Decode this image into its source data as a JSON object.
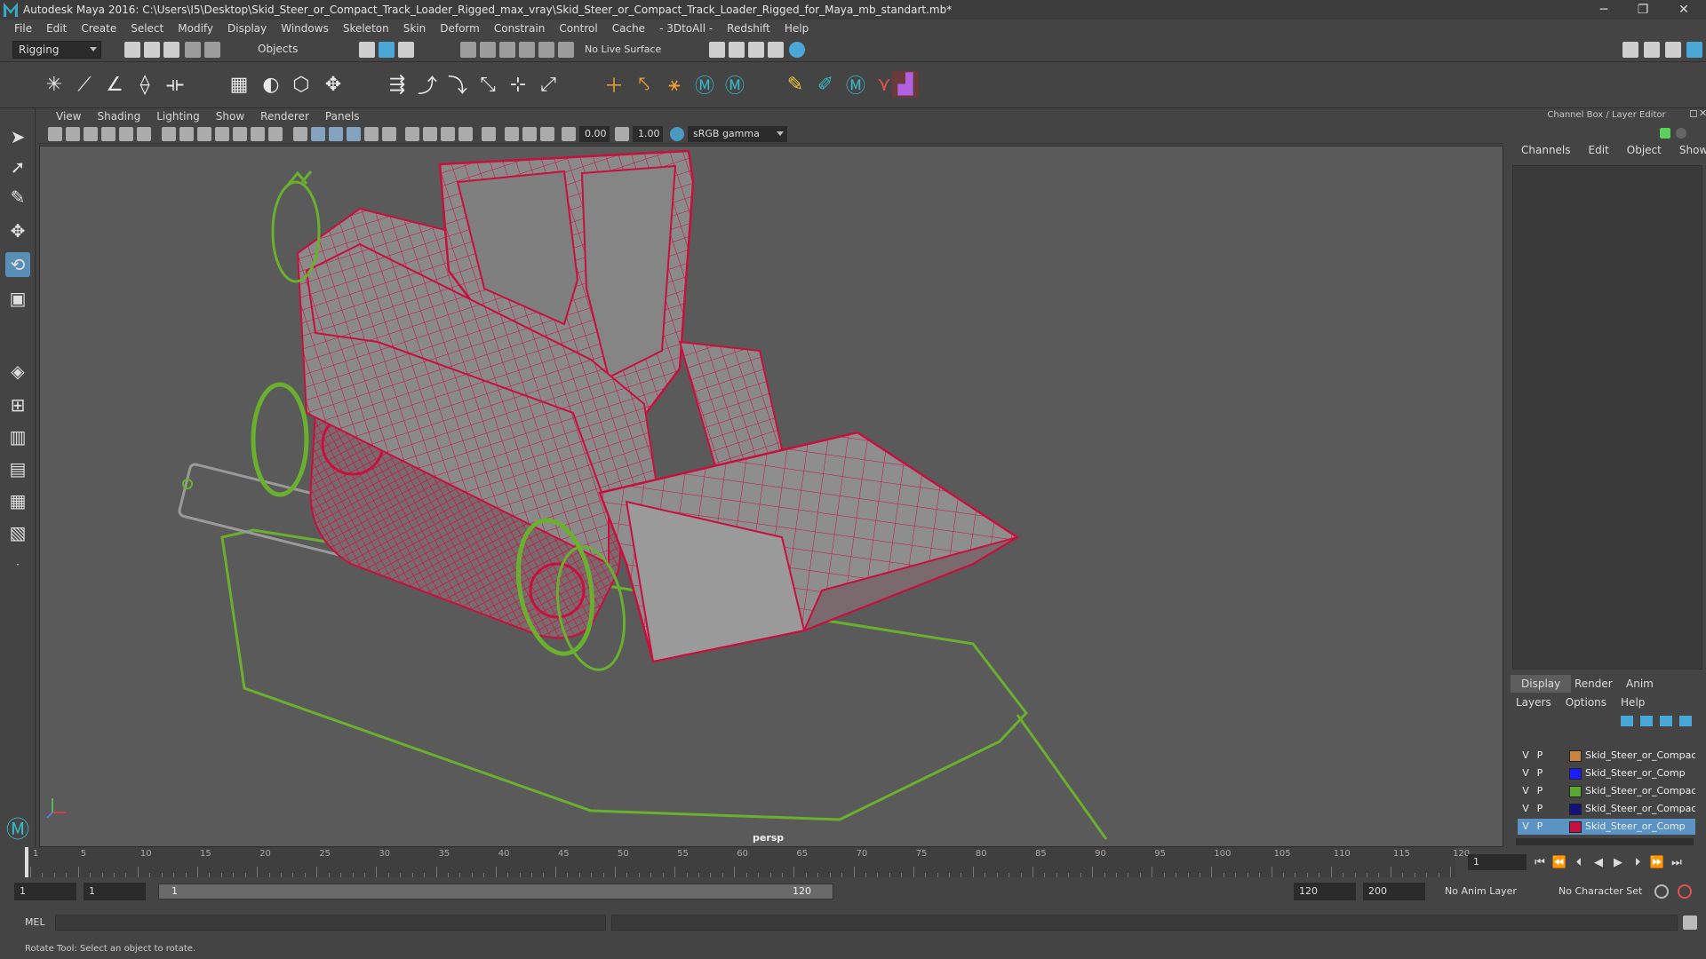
{
  "window": {
    "title": "Autodesk Maya 2016: C:\\Users\\I5\\Desktop\\Skid_Steer_or_Compact_Track_Loader_Rigged_max_vray\\Skid_Steer_or_Compact_Track_Loader_Rigged_for_Maya_mb_standart.mb*",
    "min": "─",
    "max": "❐",
    "close": "✕"
  },
  "menubar": [
    "File",
    "Edit",
    "Create",
    "Select",
    "Modify",
    "Display",
    "Windows",
    "Skeleton",
    "Skin",
    "Deform",
    "Constrain",
    "Control",
    "Cache",
    "- 3DtoAll -",
    "Redshift",
    "Help"
  ],
  "statusline": {
    "mode": "Rigging",
    "selection_mode": "Objects",
    "live_surface": "No Live Surface"
  },
  "viewport": {
    "menu": [
      "View",
      "Shading",
      "Lighting",
      "Show",
      "Renderer",
      "Panels"
    ],
    "exposure": "0.00",
    "gamma": "1.00",
    "color_space": "sRGB gamma",
    "camera_label": "persp"
  },
  "channel_box": {
    "header": "Channel Box / Layer Editor",
    "tabs": [
      "Channels",
      "Edit",
      "Object",
      "Show"
    ]
  },
  "layer_editor": {
    "tabs": [
      "Display",
      "Render",
      "Anim"
    ],
    "menu": [
      "Layers",
      "Options",
      "Help"
    ],
    "layers": [
      {
        "v": "V",
        "p": "P",
        "color": "#c9843f",
        "name": "Skid_Steer_or_Compac"
      },
      {
        "v": "V",
        "p": "P",
        "color": "#1b1bff",
        "name": "Skid_Steer_or_Comp"
      },
      {
        "v": "V",
        "p": "P",
        "color": "#5aa832",
        "name": "Skid_Steer_or_Compact_Tr"
      },
      {
        "v": "V",
        "p": "P",
        "color": "#12127a",
        "name": "Skid_Steer_or_Compact_"
      },
      {
        "v": "V",
        "p": "P",
        "color": "#c8103f",
        "name": "Skid_Steer_or_Comp",
        "selected": true
      }
    ]
  },
  "timeline": {
    "ticks": [
      "1",
      "5",
      "10",
      "15",
      "20",
      "25",
      "30",
      "35",
      "40",
      "45",
      "50",
      "55",
      "60",
      "65",
      "70",
      "75",
      "80",
      "85",
      "90",
      "95",
      "100",
      "105",
      "110",
      "115",
      "120"
    ],
    "current_frame": "1"
  },
  "range": {
    "start": "1",
    "start2": "1",
    "slider_start": "1",
    "slider_end": "120",
    "end": "120",
    "max": "200",
    "anim_layer": "No Anim Layer",
    "char_set": "No Character Set"
  },
  "cmdline": {
    "label": "MEL"
  },
  "helpline": {
    "text": "Rotate Tool: Select an object to rotate."
  },
  "colors": {
    "wire": "#c8103f",
    "rig": "#6ab02e",
    "accent": "#5b94c4"
  }
}
